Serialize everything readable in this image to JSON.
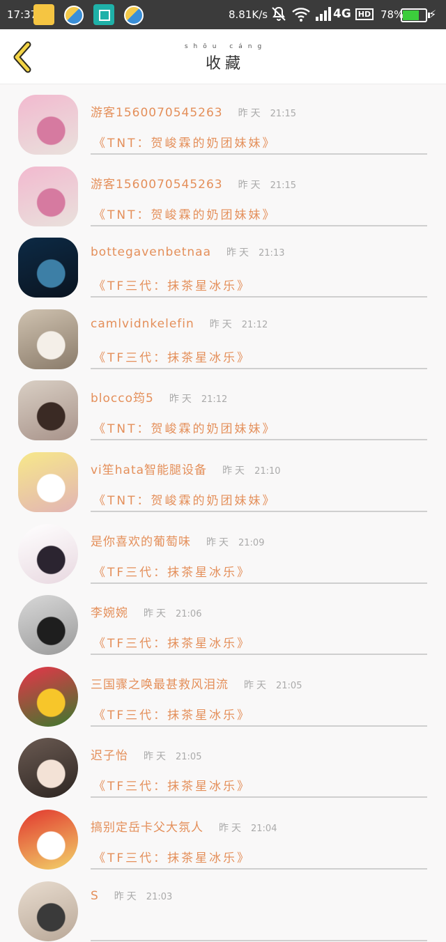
{
  "status_bar": {
    "time": "17:37",
    "net_speed": "8.81K/s",
    "network": "4G",
    "hd": "HD",
    "battery_pct": "78%",
    "battery_level": 0.78
  },
  "header": {
    "title_pinyin": "shōu cáng",
    "title": "收藏"
  },
  "items": [
    {
      "name": "游客1560070545263",
      "time_label": "昨天",
      "time": "21:15",
      "collection": "《TNT：贺峻霖的奶团妹妹》",
      "avatar_colors": [
        "#f2b9cf",
        "#d67aa0",
        "#e9e1dc"
      ]
    },
    {
      "name": "游客1560070545263",
      "time_label": "昨天",
      "time": "21:15",
      "collection": "《TNT：贺峻霖的奶团妹妹》",
      "avatar_colors": [
        "#f2b9cf",
        "#d67aa0",
        "#e9e1dc"
      ]
    },
    {
      "name": "bottegavenbetnaa",
      "time_label": "昨天",
      "time": "21:13",
      "collection": "《TF三代：抹茶星冰乐》",
      "avatar_colors": [
        "#0d2a45",
        "#3d7fa6",
        "#0a1420"
      ]
    },
    {
      "name": "camlvidnkelefin",
      "time_label": "昨天",
      "time": "21:12",
      "collection": "《TF三代：抹茶星冰乐》",
      "avatar_colors": [
        "#cfc2b0",
        "#f4efe8",
        "#8a7b6a"
      ]
    },
    {
      "name": "blocco筠5",
      "time_label": "昨天",
      "time": "21:12",
      "collection": "《TNT：贺峻霖的奶团妹妹》",
      "avatar_colors": [
        "#d9cfc4",
        "#3a2a24",
        "#a8938a"
      ]
    },
    {
      "name": "vi笙hata智能腿设备",
      "time_label": "昨天",
      "time": "21:10",
      "collection": "《TNT：贺峻霖的奶团妹妹》",
      "avatar_colors": [
        "#f7e88a",
        "#ffffff",
        "#e2b4b4"
      ]
    },
    {
      "name": "是你喜欢的葡萄味",
      "time_label": "昨天",
      "time": "21:09",
      "collection": "《TF三代：抹茶星冰乐》",
      "avatar_colors": [
        "#ffffff",
        "#2b2430",
        "#e8d8e0"
      ]
    },
    {
      "name": "李婉婉",
      "time_label": "昨天",
      "time": "21:06",
      "collection": "《TF三代：抹茶星冰乐》",
      "avatar_colors": [
        "#d8d8d8",
        "#1e1e1e",
        "#9a9a9a"
      ]
    },
    {
      "name": "三国骤之唤最甚救风泪流",
      "time_label": "昨天",
      "time": "21:05",
      "collection": "《TF三代：抹茶星冰乐》",
      "avatar_colors": [
        "#e8344a",
        "#f7c62a",
        "#3c7a2e"
      ]
    },
    {
      "name": "迟子怡",
      "time_label": "昨天",
      "time": "21:05",
      "collection": "《TF三代：抹茶星冰乐》",
      "avatar_colors": [
        "#6a5a52",
        "#f3e2d6",
        "#2e2622"
      ]
    },
    {
      "name": "搞别定岳卡父大氛人",
      "time_label": "昨天",
      "time": "21:04",
      "collection": "《TF三代：抹茶星冰乐》",
      "avatar_colors": [
        "#e1362e",
        "#ffffff",
        "#f2d36a"
      ]
    },
    {
      "name": "S",
      "time_label": "昨天",
      "time": "21:03",
      "collection": "",
      "avatar_colors": [
        "#e8dccf",
        "#3a3a3a",
        "#b9a898"
      ]
    }
  ]
}
